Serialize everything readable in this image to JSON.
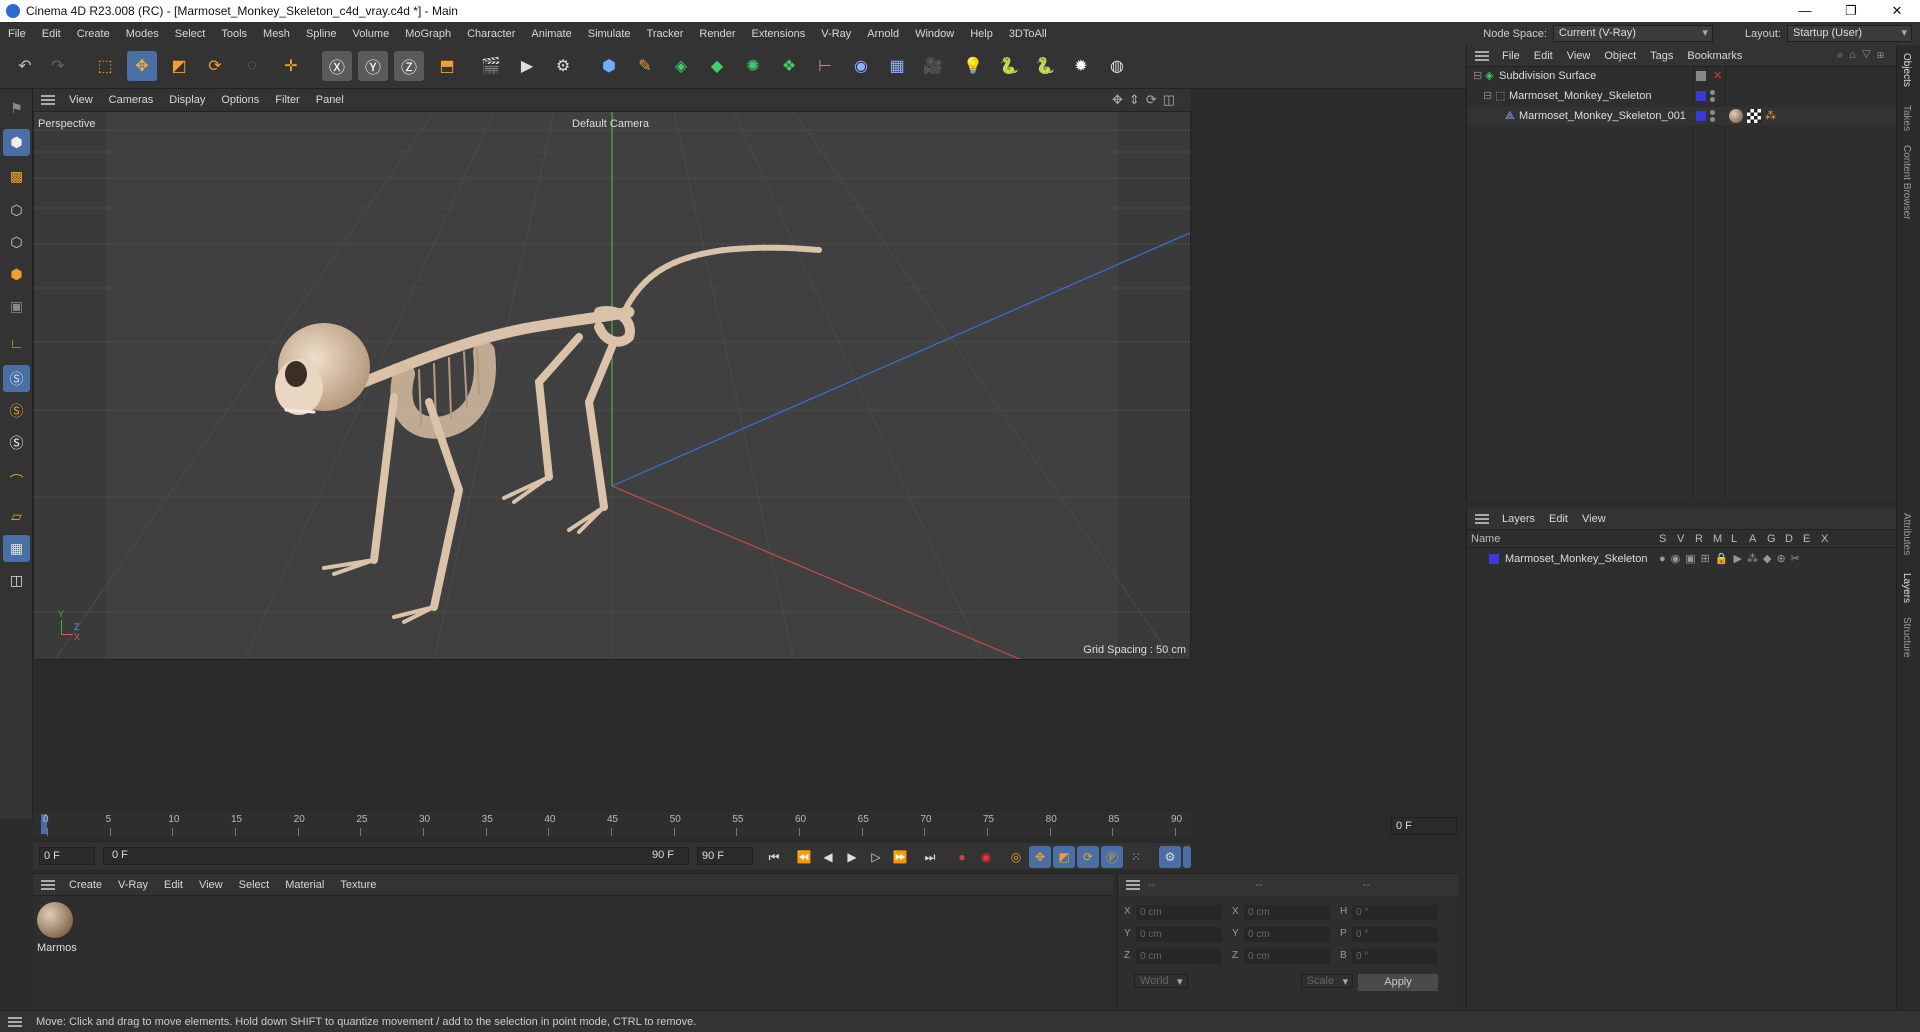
{
  "window": {
    "title": "Cinema 4D R23.008 (RC) - [Marmoset_Monkey_Skeleton_c4d_vray.c4d *] - Main",
    "minimize": "—",
    "maximize": "❐",
    "close": "✕"
  },
  "menu": {
    "items": [
      "File",
      "Edit",
      "Create",
      "Modes",
      "Select",
      "Tools",
      "Mesh",
      "Spline",
      "Volume",
      "MoGraph",
      "Character",
      "Animate",
      "Simulate",
      "Tracker",
      "Render",
      "Extensions",
      "V-Ray",
      "Arnold",
      "Window",
      "Help",
      "3DToAll"
    ],
    "node_space_label": "Node Space:",
    "node_space_value": "Current (V-Ray)",
    "layout_label": "Layout:",
    "layout_value": "Startup (User)"
  },
  "viewport": {
    "menu": [
      "View",
      "Cameras",
      "Display",
      "Options",
      "Filter",
      "Panel"
    ],
    "view_name": "Perspective",
    "camera_label": "Default Camera",
    "grid_spacing": "Grid Spacing : 50 cm",
    "axis_labels": {
      "y": "Y",
      "z": "Z",
      "x": "X"
    }
  },
  "timeline": {
    "ticks": [
      "0",
      "5",
      "10",
      "15",
      "20",
      "25",
      "30",
      "35",
      "40",
      "45",
      "50",
      "55",
      "60",
      "65",
      "70",
      "75",
      "80",
      "85",
      "90"
    ],
    "current_frame_right": "0 F",
    "start_frame": "0 F",
    "range_start": "0 F",
    "range_end": "90 F",
    "end_frame": "90 F"
  },
  "material_manager": {
    "menu": [
      "Create",
      "V-Ray",
      "Edit",
      "View",
      "Select",
      "Material",
      "Texture"
    ],
    "materials": [
      {
        "name": "Marmos"
      }
    ]
  },
  "coordinates": {
    "header": [
      "--",
      "--",
      "--"
    ],
    "rows": [
      {
        "pos_label": "X",
        "pos": "0 cm",
        "size_label": "X",
        "size": "0 cm",
        "rot_label": "H",
        "rot": "0 °"
      },
      {
        "pos_label": "Y",
        "pos": "0 cm",
        "size_label": "Y",
        "size": "0 cm",
        "rot_label": "P",
        "rot": "0 °"
      },
      {
        "pos_label": "Z",
        "pos": "0 cm",
        "size_label": "Z",
        "size": "0 cm",
        "rot_label": "B",
        "rot": "0 °"
      }
    ],
    "mode": "World",
    "size_mode": "Scale",
    "apply": "Apply"
  },
  "object_manager": {
    "menu": [
      "File",
      "Edit",
      "View",
      "Object",
      "Tags",
      "Bookmarks"
    ],
    "objects": [
      {
        "name": "Subdivision Surface"
      },
      {
        "name": "Marmoset_Monkey_Skeleton"
      },
      {
        "name": "Marmoset_Monkey_Skeleton_001"
      }
    ]
  },
  "layer_manager": {
    "menu": [
      "Layers",
      "Edit",
      "View"
    ],
    "name_header": "Name",
    "columns": [
      "S",
      "V",
      "R",
      "M",
      "L",
      "A",
      "G",
      "D",
      "E",
      "X"
    ],
    "layers": [
      {
        "name": "Marmoset_Monkey_Skeleton",
        "color": "#3a3ad8"
      }
    ]
  },
  "side_tabs": [
    "Objects",
    "Takes",
    "Content Browser",
    "Attributes",
    "Layers",
    "Structure"
  ],
  "status": "Move: Click and drag to move elements. Hold down SHIFT to quantize movement / add to the selection in point mode, CTRL to remove.",
  "colors": {
    "accent": "#4a6fa5",
    "bone": "#d9c2a8",
    "axis_x": "#c84a4a",
    "axis_y": "#4ab04a",
    "axis_z": "#3a6fd8"
  }
}
